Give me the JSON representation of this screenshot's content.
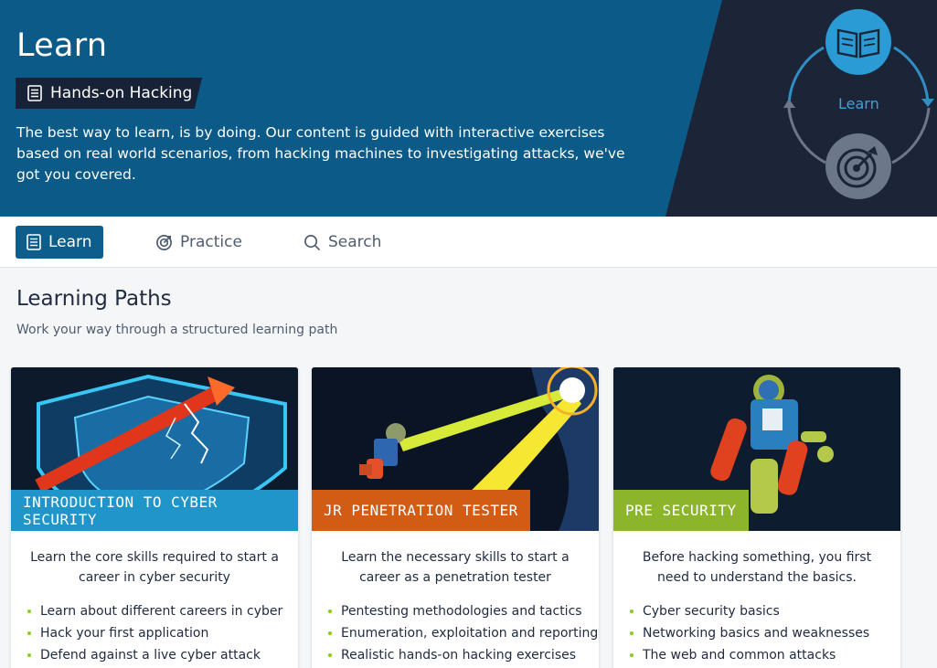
{
  "hero": {
    "title": "Learn",
    "badge_label": "Hands-on Hacking",
    "description": "The best way to learn, is by doing. Our content is guided with interactive exercises based on real world scenarios, from hacking machines to investigating attacks, we've got you covered.",
    "cycle_label": "Learn",
    "icons": [
      "book-icon",
      "target-icon"
    ]
  },
  "tabs": [
    {
      "label": "Learn",
      "icon": "book-icon",
      "active": true
    },
    {
      "label": "Practice",
      "icon": "target-icon",
      "active": false
    },
    {
      "label": "Search",
      "icon": "search-icon",
      "active": false
    }
  ],
  "section": {
    "title": "Learning Paths",
    "subtitle": "Work your way through a structured learning path"
  },
  "cards": [
    {
      "tag": "INTRODUCTION TO CYBER SECURITY",
      "tag_color": "#1f95c9",
      "description": "Learn the core skills required to start a career in cyber security",
      "bullets": [
        "Learn about different careers in cyber",
        "Hack your first application",
        "Defend against a live cyber attack"
      ]
    },
    {
      "tag": "JR PENETRATION TESTER",
      "tag_color": "#d35c14",
      "description": "Learn the necessary skills to start a career as a penetration tester",
      "bullets": [
        "Pentesting methodologies and tactics",
        "Enumeration, exploitation and reporting",
        "Realistic hands-on hacking exercises"
      ]
    },
    {
      "tag": "PRE SECURITY",
      "tag_color": "#8cb52b",
      "description": "Before hacking something, you first need to understand the basics.",
      "bullets": [
        "Cyber security basics",
        "Networking basics and weaknesses",
        "The web and common attacks"
      ]
    }
  ],
  "colors": {
    "hero_blue": "#0b5a88",
    "hero_dark": "#1c2538",
    "accent_blue": "#0d5e8d",
    "bullet_green": "#88cc14"
  }
}
